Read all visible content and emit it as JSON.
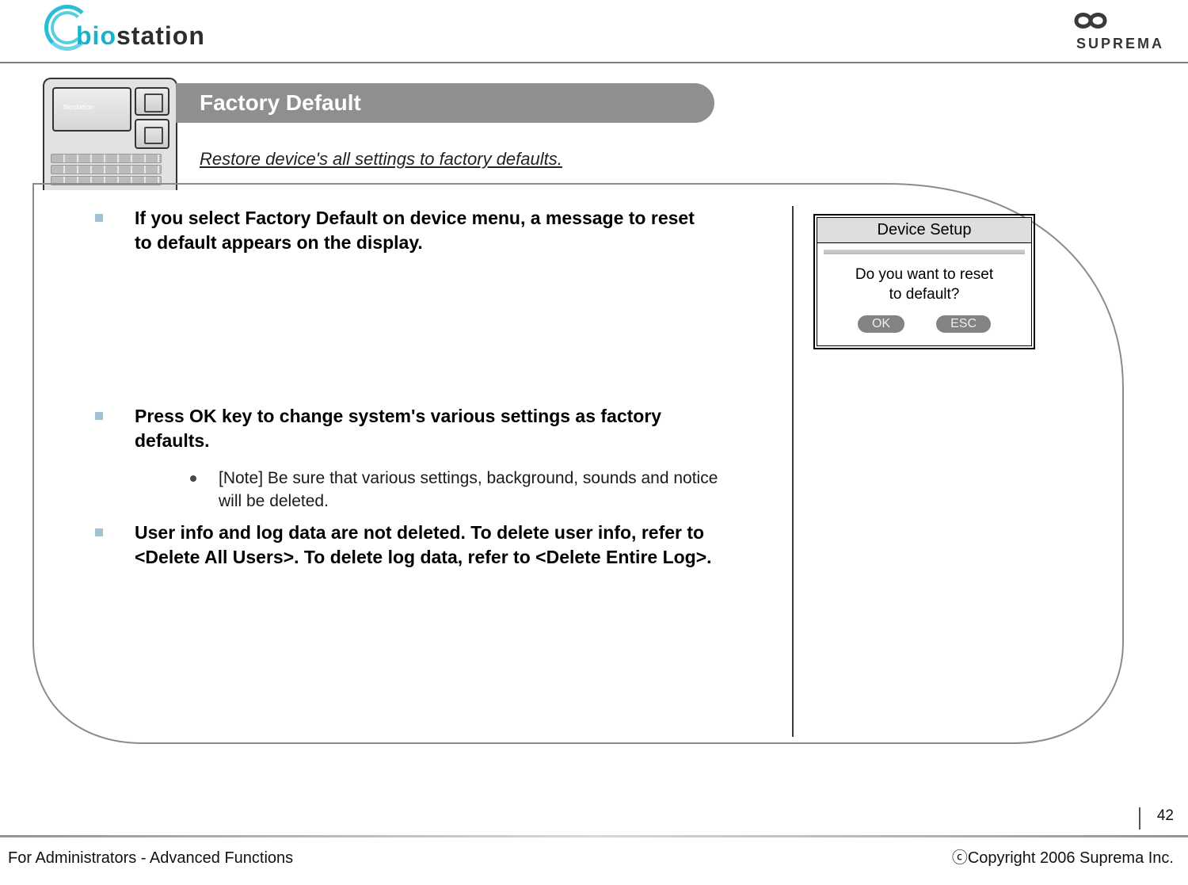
{
  "logo_left": {
    "text_a": "bio",
    "text_b": "station"
  },
  "logo_right": {
    "brand": "SUPREMA"
  },
  "banner": {
    "title": "Factory Default"
  },
  "subtitle": "Restore device's all settings to factory defaults.",
  "device_label": "biostation",
  "bullets": {
    "b1": "If you select Factory Default on device menu, a message to reset to default appears on the display.",
    "b2": "Press OK key to change system's various settings as factory defaults.",
    "b2_sub": "[Note] Be sure that various settings, background, sounds and notice will be deleted.",
    "b3": "User info and log data are not deleted. To delete user info, refer to <Delete All Users>. To delete log data, refer to  <Delete Entire Log>."
  },
  "popup": {
    "header": "Device Setup",
    "msg_line1": "Do you want to reset",
    "msg_line2": "to default?",
    "ok": "OK",
    "esc": "ESC"
  },
  "footer": {
    "left": "For Administrators - Advanced Functions",
    "right": "ⓒCopyright 2006 Suprema Inc.",
    "page": "42"
  }
}
